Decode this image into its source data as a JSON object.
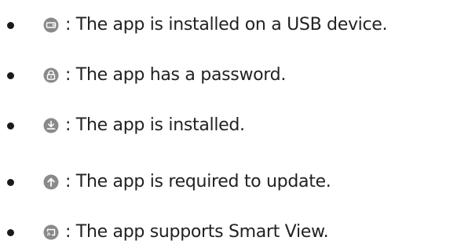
{
  "legend": {
    "items": [
      {
        "icon": "usb-device-icon",
        "text": ": The app is installed on a USB device."
      },
      {
        "icon": "lock-icon",
        "text": ": The app has a password."
      },
      {
        "icon": "download-installed-icon",
        "text": ": The app is installed."
      },
      {
        "icon": "update-arrow-icon",
        "text": ": The app is required to update."
      },
      {
        "icon": "smart-view-cast-icon",
        "text": ": The app supports Smart View."
      }
    ]
  },
  "colors": {
    "icon_fill": "#8a8a8a",
    "icon_glyph": "#ffffff",
    "text": "#222222",
    "bullet": "#1a1a1a"
  }
}
